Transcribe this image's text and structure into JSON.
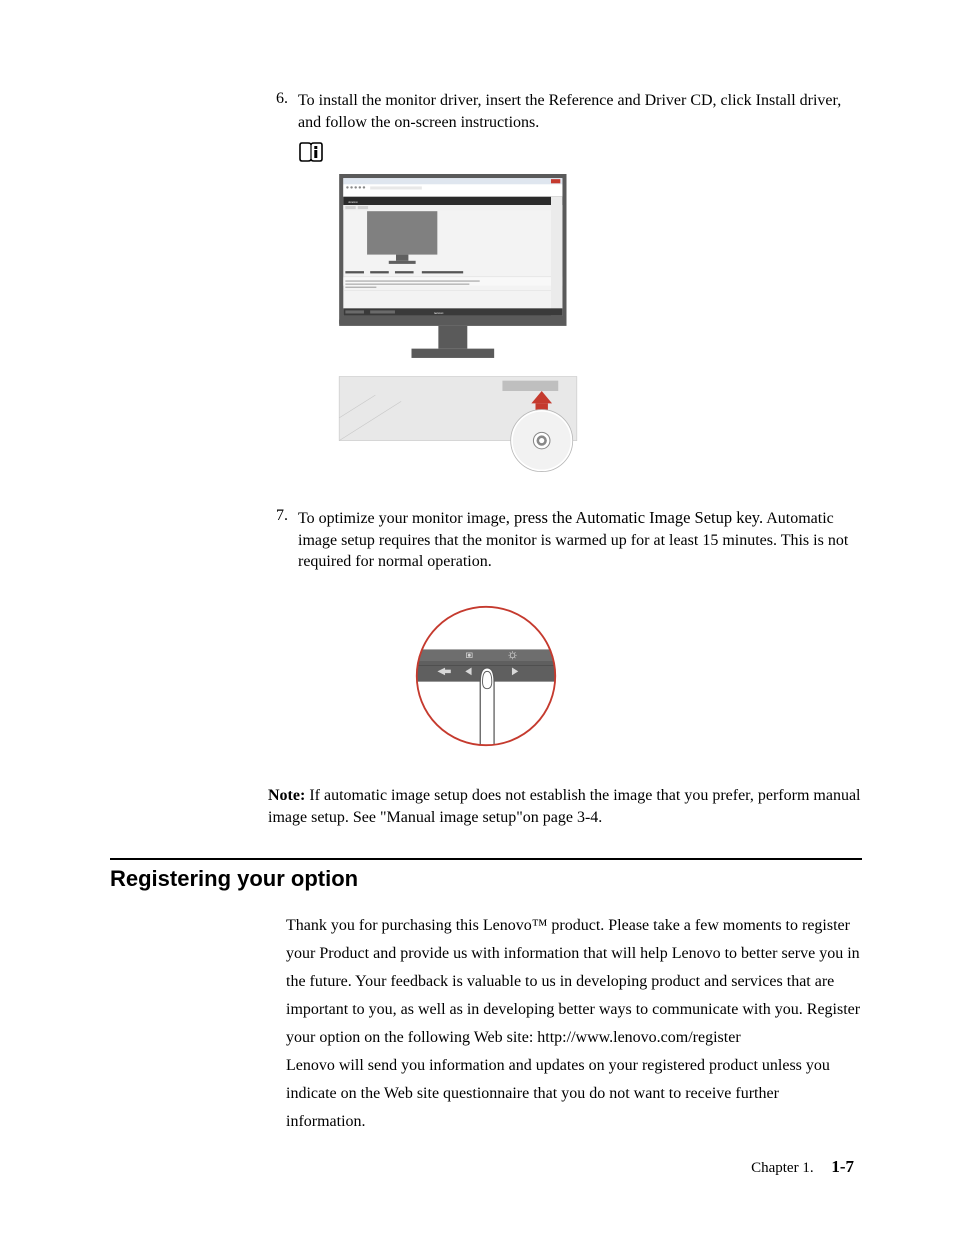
{
  "steps": {
    "6": {
      "num": "6.",
      "text": "To install the monitor driver, insert the Reference and Driver CD, click Install driver, and follow the on-screen instructions."
    },
    "7": {
      "num": "7.",
      "text_a": "To optimize your monitor image",
      "text_b": ", press the Automatic Image Setup key.",
      "text_c": "Automatic image setup requires that the monitor is warmed up for at least 15 minutes. This is not required for normal operation."
    }
  },
  "note": {
    "label": "Note:",
    "text": " If automatic image setup does not establish the image that you prefer, perform manual image setup. See \"Manual image setup\"on page 3-4."
  },
  "section": {
    "heading": "Registering your option",
    "body": "Thank you for purchasing this Lenovo™ product. Please take a few moments to register your Product and provide us with information that will help Lenovo to better serve you in the future. Your feedback is valuable to us in developing product and services that are important to you, as well as in developing better ways to communicate with you. Register your option on the following Web site: http://www.lenovo.com/register",
    "body2": "Lenovo will send you information and updates on your registered product unless you indicate on the Web site questionnaire that you do not want to receive further information."
  },
  "footer": {
    "chapter": "Chapter 1.",
    "page": "1-7"
  },
  "figure_labels": {
    "brand": "lenovo"
  }
}
